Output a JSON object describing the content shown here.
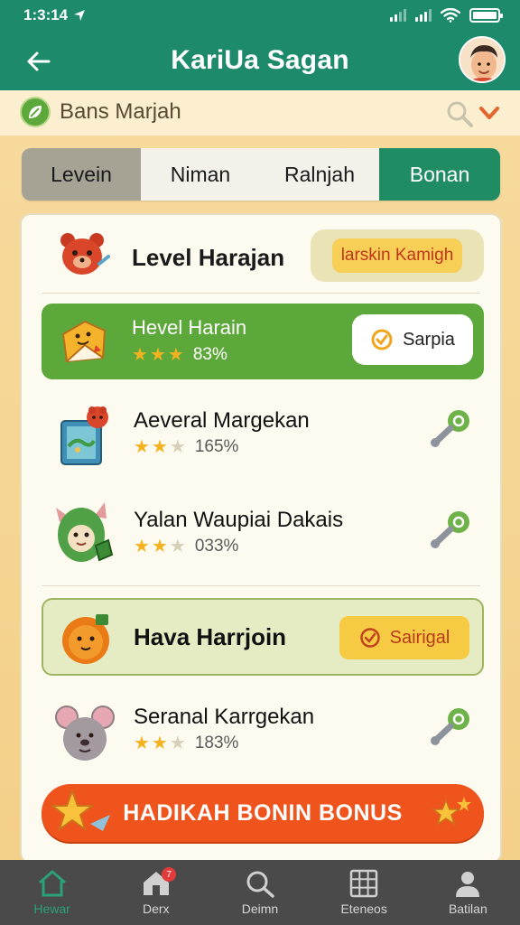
{
  "status": {
    "time": "1:3:14"
  },
  "header": {
    "title": "KariUa Sagan"
  },
  "brand": {
    "label": "Bans Marjah"
  },
  "tabs": [
    {
      "label": "Levein"
    },
    {
      "label": "Niman"
    },
    {
      "label": "Ralnjah"
    },
    {
      "label": "Bonan"
    }
  ],
  "level_header": {
    "title": "Level Harajan",
    "badge": "larskin Kamigh"
  },
  "levels": [
    {
      "title": "Hevel Harain",
      "stars": 3,
      "percent": "83%",
      "action": "Sarpia"
    },
    {
      "title": "Aeveral Margekan",
      "stars": 2.5,
      "percent": "165%"
    },
    {
      "title": "Yalan Waupiai Dakais",
      "stars": 2.5,
      "percent": "033%"
    },
    {
      "title": "Hava Harrjoin",
      "action": "Sairigal"
    },
    {
      "title": "Seranal Karrgekan",
      "stars": 2.5,
      "percent": "183%"
    }
  ],
  "bonus": {
    "label": "HADIKAH BONIN BONUS"
  },
  "nav": [
    {
      "label": "Hewar",
      "icon": "home-icon"
    },
    {
      "label": "Derx",
      "icon": "house-badge-icon",
      "badge": "7"
    },
    {
      "label": "Deimn",
      "icon": "search-icon"
    },
    {
      "label": "Eteneos",
      "icon": "grid-icon"
    },
    {
      "label": "Batilan",
      "icon": "profile-icon"
    }
  ],
  "colors": {
    "primary": "#1e8a6c",
    "green": "#5da83b",
    "orange": "#f0541d",
    "yellow": "#f7ca44",
    "bottom_nav": "#4a4a4a"
  }
}
